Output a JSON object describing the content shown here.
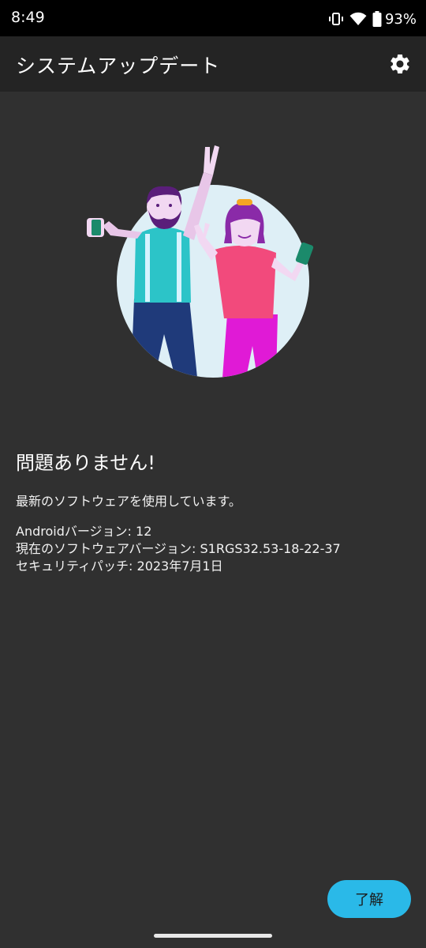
{
  "status_bar": {
    "time": "8:49",
    "battery_percent": "93%",
    "icons": [
      "vibrate-icon",
      "wifi-icon",
      "battery-icon"
    ]
  },
  "app_bar": {
    "title": "システムアップデート",
    "settings_icon": "gear-icon"
  },
  "content": {
    "heading": "問題ありません!",
    "message": "最新のソフトウェアを使用しています。",
    "android_version": "Androidバージョン: 12",
    "software_version": "現在のソフトウェアバージョン: S1RGS32.53-18-22-37",
    "security_patch": "セキュリティパッチ: 2023年7月1日"
  },
  "actions": {
    "ok_label": "了解"
  },
  "colors": {
    "background": "#303030",
    "app_bar": "#242424",
    "accent": "#2ab9e8"
  }
}
